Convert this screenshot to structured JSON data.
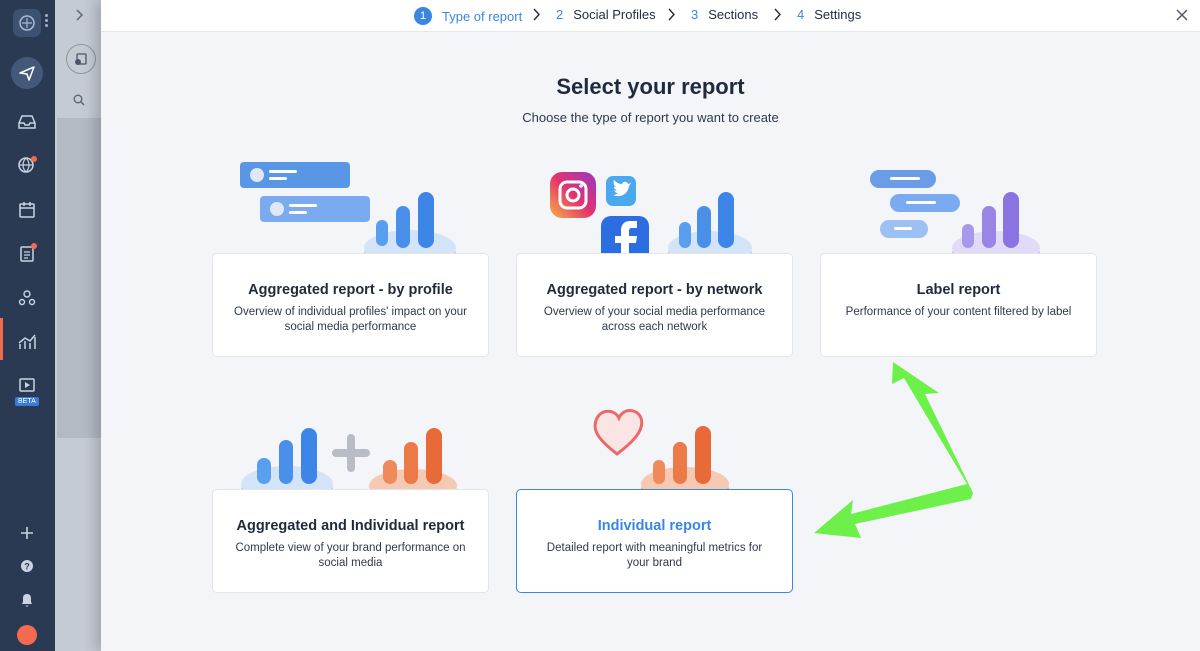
{
  "nav": {
    "beta_label": "BETA"
  },
  "stepper": {
    "steps": [
      {
        "num": "1",
        "label": "Type of report"
      },
      {
        "num": "2",
        "label": "Social Profiles"
      },
      {
        "num": "3",
        "label": "Sections"
      },
      {
        "num": "4",
        "label": "Settings"
      }
    ]
  },
  "page": {
    "title": "Select your report",
    "subtitle": "Choose the type of report you want to create"
  },
  "cards": [
    {
      "title": "Aggregated report - by profile",
      "desc": "Overview of individual profiles' impact on your social media performance"
    },
    {
      "title": "Aggregated report - by network",
      "desc": "Overview of your social media performance across each network"
    },
    {
      "title": "Label report",
      "desc": "Performance of your content filtered by label"
    },
    {
      "title": "Aggregated and Individual report",
      "desc": "Complete view of your brand performance on social media"
    },
    {
      "title": "Individual report",
      "desc": "Detailed report with meaningful metrics for your brand"
    }
  ],
  "colors": {
    "accent": "#3a86e0",
    "rail": "#2a3a52",
    "arrow": "#6ef04a",
    "orange": "#f07a4a",
    "blue_bars": "#5a9ef0",
    "purple_bars": "#9a85e6"
  }
}
